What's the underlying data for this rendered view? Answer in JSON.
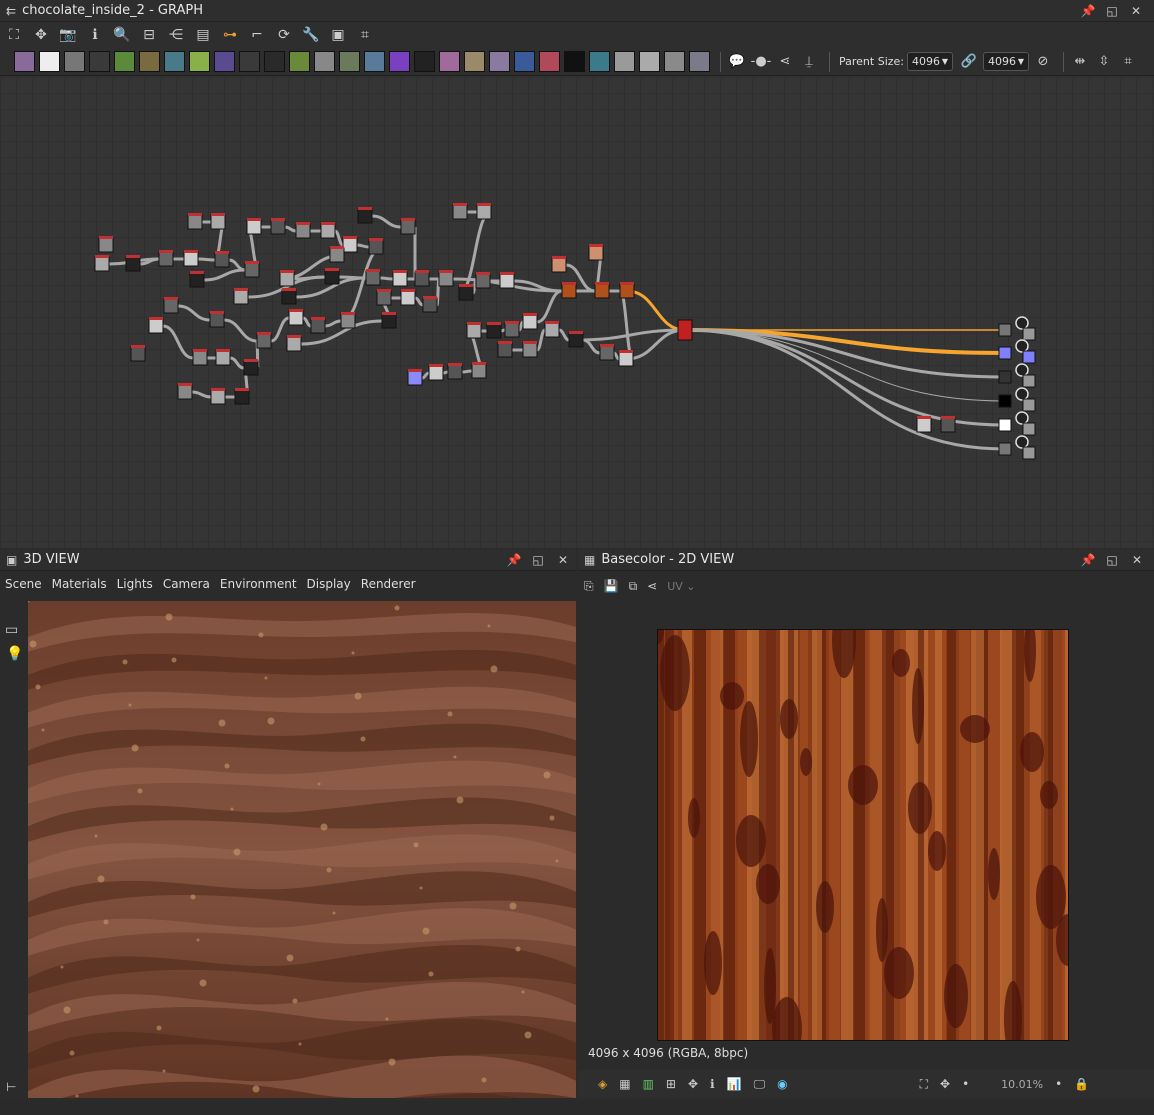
{
  "graph": {
    "title": "chocolate_inside_2 - GRAPH",
    "parent_size_label": "Parent Size:",
    "parent_size_value": "4096",
    "output_size_value": "4096"
  },
  "view3d": {
    "title": "3D VIEW",
    "menu": [
      "Scene",
      "Materials",
      "Lights",
      "Camera",
      "Environment",
      "Display",
      "Renderer"
    ]
  },
  "view2d": {
    "title": "Basecolor - 2D VIEW",
    "uv_label": "UV",
    "resolution_text": "4096 x 4096 (RGBA, 8bpc)",
    "zoom": "10.01%"
  },
  "colors": {
    "accent": "#f0a030",
    "link": "#a8a8a8",
    "output_link": "#f5a530"
  },
  "icons": {
    "graph_title": "graph-icon",
    "pin": "pin-icon",
    "maximize": "maximize-icon",
    "close": "close-icon"
  }
}
